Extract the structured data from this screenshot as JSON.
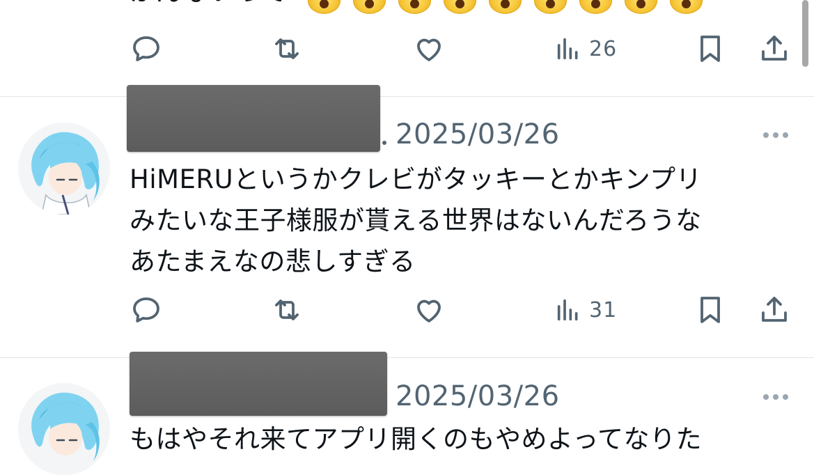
{
  "top_tweet": {
    "text_fragment": "かんないって",
    "emoji": "face-screaming-in-fear",
    "emoji_count": 9,
    "views": "26"
  },
  "tweets": [
    {
      "date": "2025/03/26",
      "separator": "·",
      "lines": [
        "HiMERUというかクレビがタッキーとかキンプリ",
        "みたいな王子様服が貰える世界はないんだろうな",
        "あたまえなの悲しすぎる"
      ],
      "views": "31"
    },
    {
      "date": "2025/03/26",
      "lines": [
        "もはやそれ来てアプリ開くのもやめよってなりた"
      ]
    }
  ],
  "icons": [
    "reply-icon",
    "retweet-icon",
    "like-icon",
    "views-icon",
    "bookmark-icon",
    "share-icon",
    "more-icon"
  ],
  "colors": {
    "text": "#0f1419",
    "secondary": "#536471",
    "divider": "#e1e6ea",
    "redaction": "#606060",
    "avatar_hair": "#7fd3f0"
  }
}
